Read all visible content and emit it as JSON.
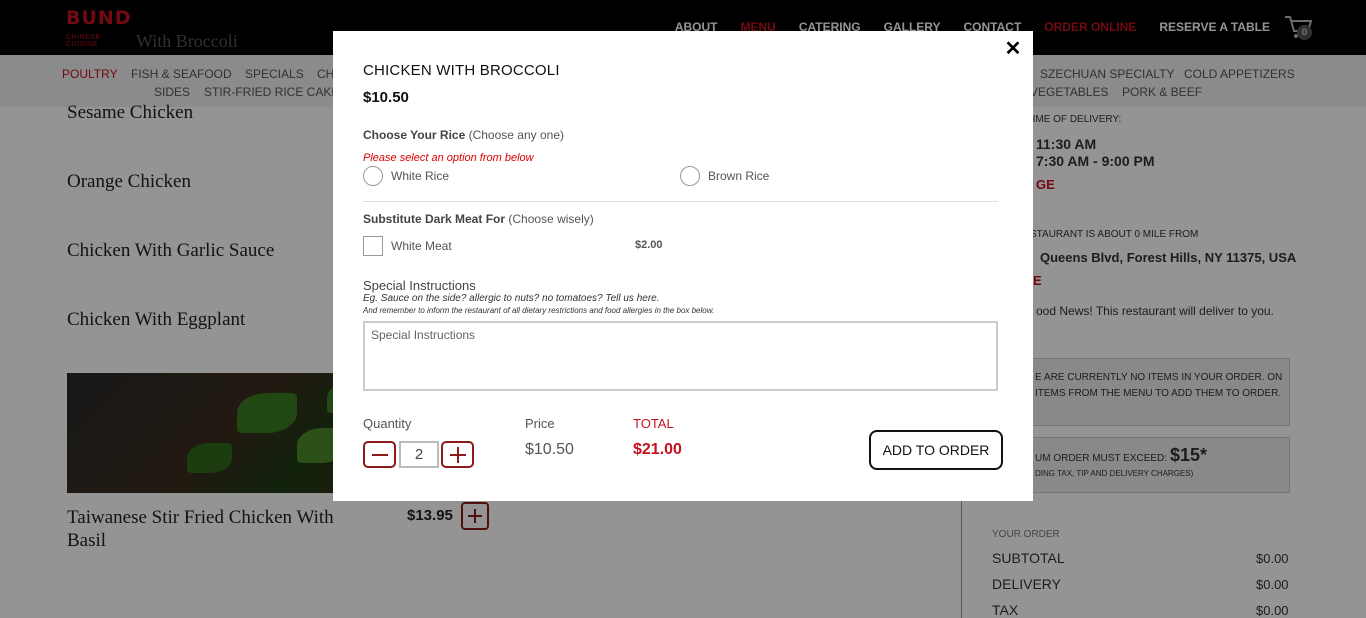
{
  "header": {
    "logo_text": "BUND",
    "logo_subtext": "CHINESE CUISINE",
    "behind_title": "With Broccoli",
    "nav": [
      "ABOUT",
      "MENU",
      "CATERING",
      "GALLERY",
      "CONTACT",
      "ORDER ONLINE",
      "RESERVE A TABLE"
    ],
    "cart_count": "0"
  },
  "categories": [
    "POULTRY",
    "FISH & SEAFOOD",
    "SPECIALS",
    "CH",
    "SIDES",
    "STIR-FRIED RICE CAKE",
    "SZECHUAN SPECIALTY",
    "COLD APPETIZERS",
    "VEGETABLES",
    "PORK & BEEF"
  ],
  "menu_items": [
    "Sesame Chicken",
    "Orange Chicken",
    "Chicken With Garlic Sauce",
    "Chicken With Eggplant"
  ],
  "featured_item": {
    "name": "Taiwanese Stir Fried Chicken With Basil",
    "price": "$13.95"
  },
  "sidebar": {
    "delivery_label": "ED TIME OF DELIVERY:",
    "delivery_time": "11:30 AM",
    "hours": "7:30 AM - 9:00 PM",
    "change_link": "GE",
    "distance_label": "STAURANT IS ABOUT 0 MILE FROM",
    "address": "Queens Blvd, Forest Hills, NY 11375, USA",
    "address_link": "E",
    "news": "ood News! This restaurant will deliver to you.",
    "empty_order": "E ARE CURRENTLY NO ITEMS IN YOUR ORDER. ON ITEMS FROM THE MENU TO ADD THEM TO ORDER.",
    "min_order_label": "UM ORDER MUST EXCEED:",
    "min_order_value": "$15*",
    "min_order_note": "DING TAX, TIP AND DELIVERY CHARGES)",
    "your_order": "YOUR ORDER",
    "totals": [
      {
        "label": "SUBTOTAL",
        "value": "$0.00"
      },
      {
        "label": "DELIVERY",
        "value": "$0.00"
      },
      {
        "label": "TAX",
        "value": "$0.00"
      }
    ]
  },
  "modal": {
    "title": "CHICKEN WITH BROCCOLI",
    "price": "$10.50",
    "rice_group": {
      "label": "Choose Your Rice",
      "hint": "(Choose any one)"
    },
    "rice_error": "Please select an option from below",
    "rice_options": [
      "White Rice",
      "Brown Rice"
    ],
    "meat_group": {
      "label": "Substitute Dark Meat For",
      "hint": "(Choose wisely)"
    },
    "meat_option": {
      "label": "White Meat",
      "price": "$2.00"
    },
    "special_instructions": {
      "title": "Special Instructions",
      "hint1": "Eg. Sauce on the side? allergic to nuts? no tomatoes? Tell us here.",
      "hint2": "And remember to inform the restaurant of all dietary restrictions and food allergies in the box below.",
      "placeholder": "Special Instructions"
    },
    "quantity_label": "Quantity",
    "quantity": "2",
    "price_label": "Price",
    "unit_price": "$10.50",
    "total_label": "TOTAL",
    "total": "$21.00",
    "add_button": "ADD TO ORDER",
    "close_glyph": "✕"
  },
  "colors": {
    "accent": "#c4121f",
    "button_border": "#8b1a1a",
    "overlay": "rgba(0,0,0,0.42)"
  }
}
